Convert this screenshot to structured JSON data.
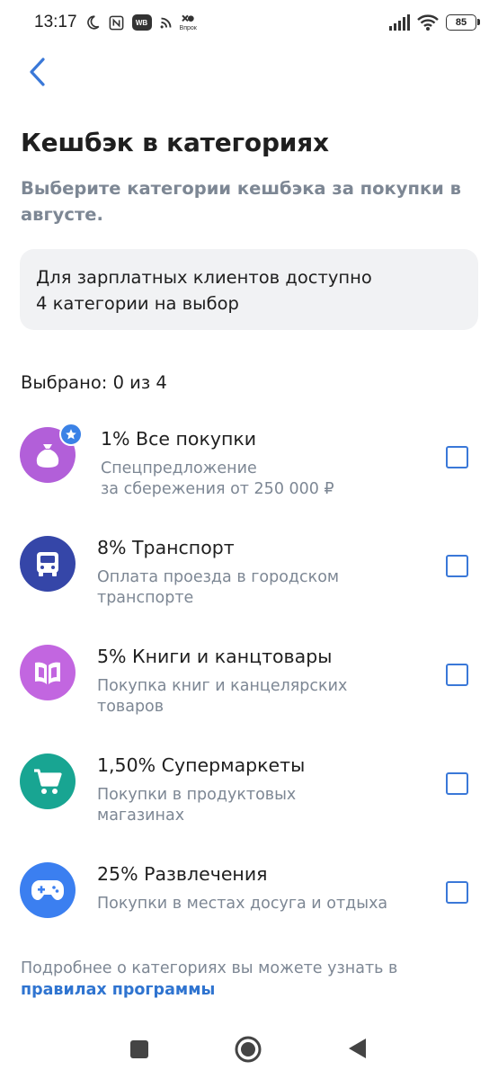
{
  "status_bar": {
    "time": "13:17",
    "wb_badge": "WB",
    "vprok": "Впрок",
    "battery": "85"
  },
  "header": {
    "back_icon": "chevron-left-icon",
    "title": "Кешбэк в категориях",
    "subtitle": "Выберите категории кешбэка за покупки в августе."
  },
  "info_card": {
    "text_line1": "Для зарплатных клиентов доступно",
    "text_line2": "4 категории на выбор"
  },
  "selected_counter": "Выбрано: 0 из 4",
  "categories": [
    {
      "title": "1% Все покупки",
      "desc_line1": "Спецпредложение",
      "desc_line2": "за сбережения от 250 000 ₽",
      "icon": "money-bag-icon",
      "color": "#b25fd9",
      "checked": false,
      "badge": "star-icon"
    },
    {
      "title": "8% Транспорт",
      "desc_line1": "Оплата проезда в городском",
      "desc_line2": "транспорте",
      "icon": "bus-icon",
      "color": "#3546a8",
      "checked": false
    },
    {
      "title": "5% Книги и канцтовары",
      "desc_line1": "Покупка книг и канцелярских",
      "desc_line2": "товаров",
      "icon": "book-icon",
      "color": "#c266e0",
      "checked": false
    },
    {
      "title": "1,50% Супермаркеты",
      "desc_line1": "Покупки в продуктовых",
      "desc_line2": "магазинах",
      "icon": "shopping-cart-icon",
      "color": "#18a592",
      "checked": false
    },
    {
      "title": "25% Развлечения",
      "desc_line1": "Покупки в местах досуга и отдыха",
      "desc_line2": "",
      "icon": "gamepad-icon",
      "color": "#3b7ff0",
      "checked": false
    }
  ],
  "footer": {
    "note": "Подробнее о категориях вы можете узнать в",
    "link": "правилах программы"
  },
  "colors": {
    "accent": "#3a78d8",
    "link": "#2f74d0",
    "muted_text": "#7d8794",
    "card_bg": "#f1f2f4"
  }
}
